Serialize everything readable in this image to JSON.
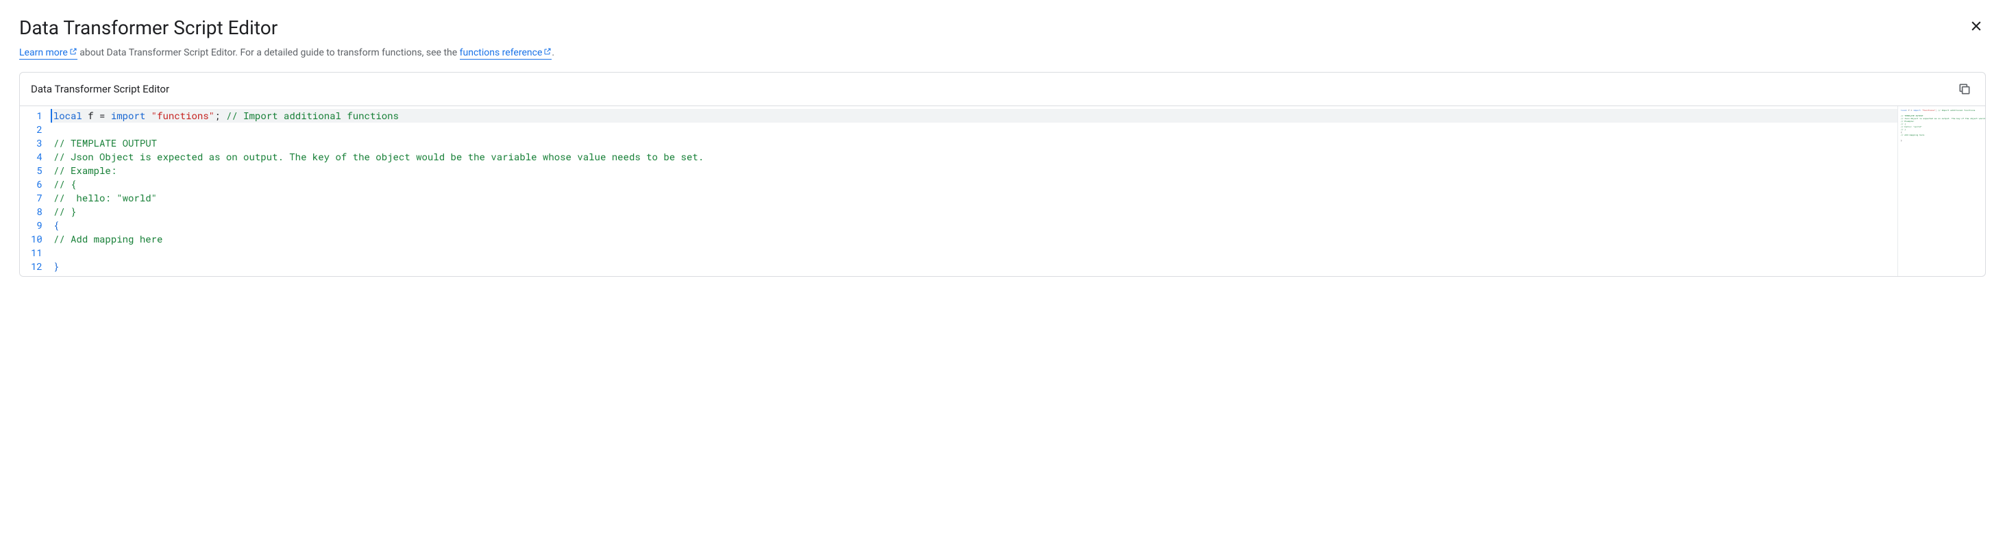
{
  "title": "Data Transformer Script Editor",
  "subtitle": {
    "link1_text": "Learn more",
    "text1": " about Data Transformer Script Editor. For a detailed guide to transform functions, see the ",
    "link2_text": "functions reference",
    "text2": "."
  },
  "panel": {
    "title": "Data Transformer Script Editor"
  },
  "code": {
    "lines": [
      {
        "num": "1",
        "tokens": [
          {
            "t": "local",
            "c": "keyword"
          },
          {
            "t": " f = ",
            "c": "plain"
          },
          {
            "t": "import",
            "c": "keyword"
          },
          {
            "t": " ",
            "c": "plain"
          },
          {
            "t": "\"functions\"",
            "c": "string"
          },
          {
            "t": "; ",
            "c": "plain"
          },
          {
            "t": "// Import additional functions",
            "c": "comment"
          }
        ],
        "highlighted": true
      },
      {
        "num": "2",
        "tokens": []
      },
      {
        "num": "3",
        "tokens": [
          {
            "t": "// TEMPLATE OUTPUT",
            "c": "comment"
          }
        ]
      },
      {
        "num": "4",
        "tokens": [
          {
            "t": "// Json Object is expected as on output. The key of the object would be the variable whose value needs to be set.",
            "c": "comment"
          }
        ]
      },
      {
        "num": "5",
        "tokens": [
          {
            "t": "// Example:",
            "c": "comment"
          }
        ]
      },
      {
        "num": "6",
        "tokens": [
          {
            "t": "// {",
            "c": "comment"
          }
        ]
      },
      {
        "num": "7",
        "tokens": [
          {
            "t": "//  hello: \"world\"",
            "c": "comment"
          }
        ]
      },
      {
        "num": "8",
        "tokens": [
          {
            "t": "// }",
            "c": "comment"
          }
        ]
      },
      {
        "num": "9",
        "tokens": [
          {
            "t": "{",
            "c": "brace"
          }
        ]
      },
      {
        "num": "10",
        "tokens": [
          {
            "t": "// Add mapping here",
            "c": "comment"
          }
        ]
      },
      {
        "num": "11",
        "tokens": []
      },
      {
        "num": "12",
        "tokens": [
          {
            "t": "}",
            "c": "brace"
          }
        ]
      }
    ]
  }
}
